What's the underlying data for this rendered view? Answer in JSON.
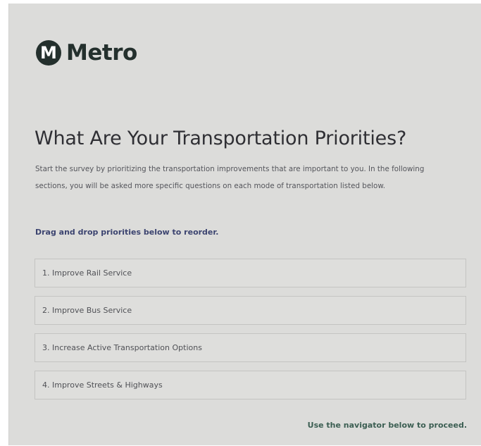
{
  "header": {
    "logo_mark": "M",
    "logo_text": "Metro"
  },
  "survey": {
    "title": "What Are Your Transportation Priorities?",
    "intro": "Start the survey by prioritizing the transportation improvements that are important to you. In the following sections, you will be asked more specific questions on each mode of transportation listed below.",
    "instruction": "Drag and drop priorities below to reorder.",
    "priorities": [
      {
        "label": "1. Improve Rail Service"
      },
      {
        "label": "2. Improve Bus Service"
      },
      {
        "label": "3. Increase Active Transportation Options"
      },
      {
        "label": "4. Improve Streets & Highways"
      }
    ],
    "nav_hint": "Use the navigator below to proceed."
  },
  "colors": {
    "panel_background": "#dcdcda",
    "logo": "#24302d",
    "instruction": "#3c4470",
    "nav_hint": "#3b5e52"
  }
}
